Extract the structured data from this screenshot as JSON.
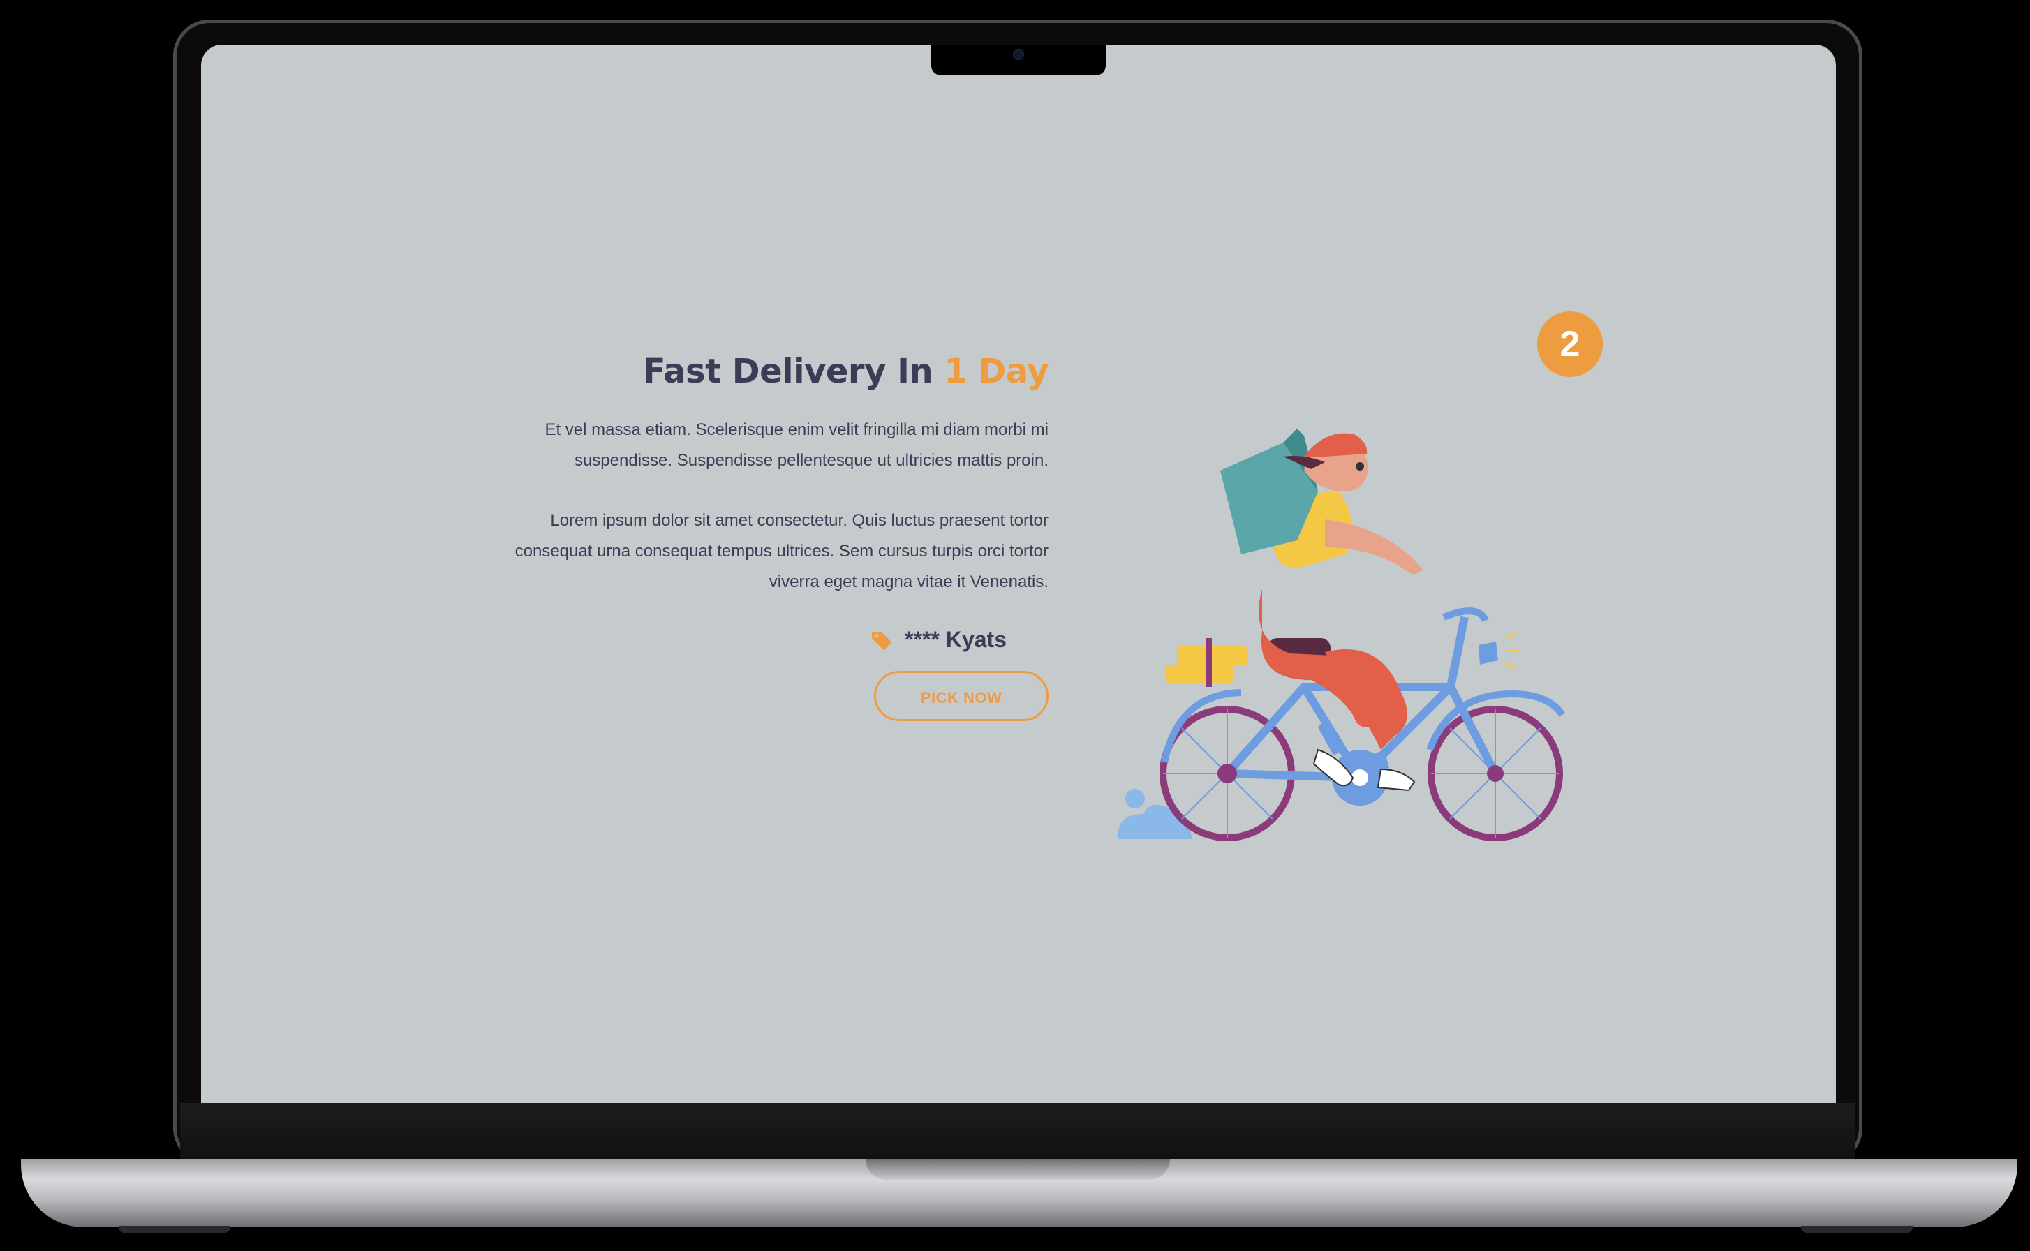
{
  "hero": {
    "title_prefix": "Fast Delivery In ",
    "title_highlight": "1 Day",
    "paragraph_1": "Et vel massa etiam. Scelerisque enim velit fringilla mi diam morbi mi suspendisse. Suspendisse pellentesque ut ultricies mattis proin.",
    "paragraph_2": "Lorem ipsum dolor sit amet consectetur. Quis luctus praesent tortor consequat urna consequat tempus ultrices. Sem cursus turpis orci tortor viverra eget magna vitae it  Venenatis.",
    "price_text": "**** Kyats",
    "price_icon": "tag-icon",
    "cta_label": "PICK NOW"
  },
  "step_badge": "2",
  "illustration": "delivery-cyclist",
  "colors": {
    "screen_bg": "#c5cbcd",
    "text": "#3b3d56",
    "accent": "#ee9c40"
  }
}
